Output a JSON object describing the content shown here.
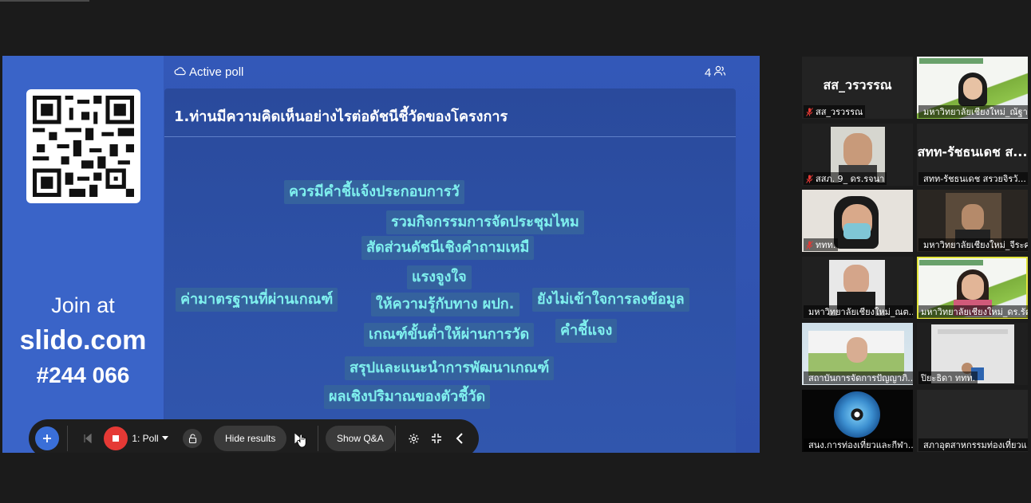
{
  "poll": {
    "status": "Active poll",
    "participants": "4",
    "question": "1.ท่านมีความคิดเห็นอย่างไรต่อดัชนีชี้วัดของโครงการ",
    "words": [
      "ควรมีคำชี้แจ้งประกอบการวั",
      "รวมกิจกรรมการจัดประชุมไหม",
      "สัดส่วนดัชนีเชิงคำถามเหมื",
      "แรงจูงใจ",
      "ค่ามาตรฐานที่ผ่านเกณฑ์",
      "ให้ความรู้กับทาง ผปก.",
      "ยังไม่เข้าใจการลงข้อมูล",
      "เกณฑ์ขั้นต่ำให้ผ่านการวัด",
      "คำชี้แจง",
      "สรุปและแนะนำการพัฒนาเกณฑ์",
      "ผลเชิงปริมาณของตัวชี้วัด"
    ]
  },
  "join": {
    "line1": "Join at",
    "site": "slido.com",
    "code": "#244 066"
  },
  "toolbar": {
    "poll_select": "1: Poll",
    "hide_results": "Hide results",
    "show_qa": "Show Q&A"
  },
  "participants": [
    {
      "label": "สส_วรวรรณ",
      "big": "สส_วรวรรณ"
    },
    {
      "label": "มหาวิทยาลัยเชียงใหม่_ณัฐา...",
      "big": ""
    },
    {
      "label": "สสภ. 9_ ดร.รจนา",
      "big": ""
    },
    {
      "label": "สทท-รัชธนเดช สรวยจิรวั...",
      "big": "สทท-รัชธนเดช ส..."
    },
    {
      "label": "ททท.",
      "big": ""
    },
    {
      "label": "มหาวิทยาลัยเชียงใหม่_จีระศ...",
      "big": ""
    },
    {
      "label": "มหาวิทยาลัยเชียงใหม่_ณต...",
      "big": ""
    },
    {
      "label": "มหาวิทยาลัยเชียงใหม่_ดร.รัตซ...",
      "big": ""
    },
    {
      "label": "สถาบันการจัดการปัญญาภิ...",
      "big": ""
    },
    {
      "label": "ปิยะธิดา ททท.",
      "big": ""
    },
    {
      "label": "สนง.การท่องเที่ยวและกีฬา...",
      "big": ""
    },
    {
      "label": "สภาอุตสาหกรรมท่องเที่ยวแ...",
      "big": ""
    }
  ],
  "colors": {
    "accent": "#3a64c8",
    "word": "#7ff0ee",
    "record": "#e53935",
    "active_speaker": "#e2e53a"
  }
}
